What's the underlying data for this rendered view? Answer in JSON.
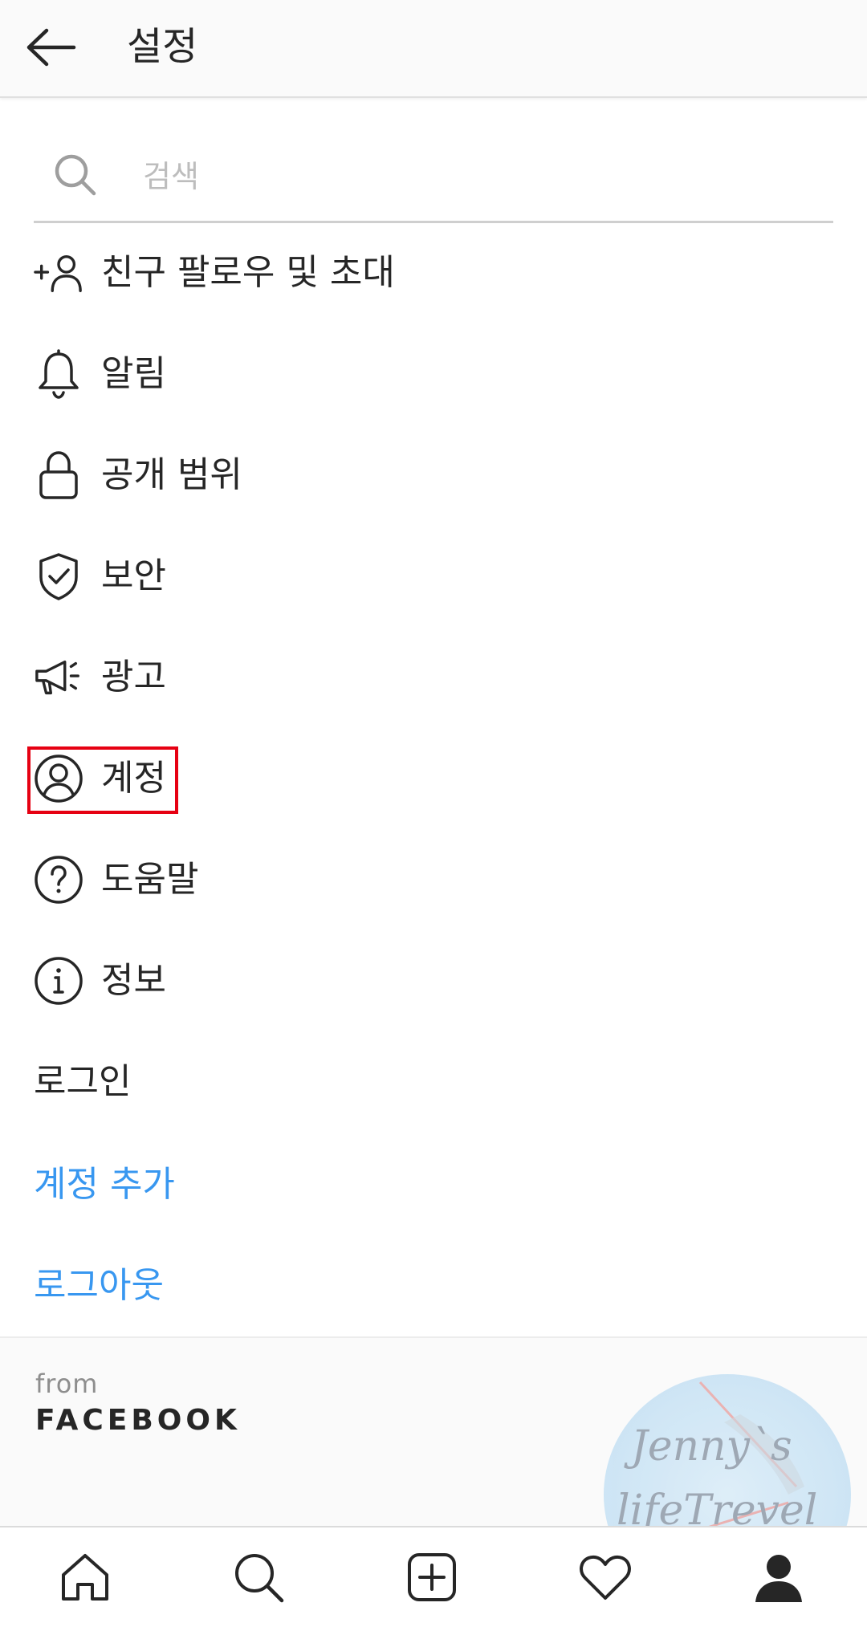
{
  "header": {
    "title": "설정",
    "back_icon": "arrow-left-icon"
  },
  "search": {
    "placeholder": "검색",
    "value": "",
    "icon": "search-icon"
  },
  "menu": {
    "items": [
      {
        "label": "친구 팔로우 및 초대",
        "icon": "add-person-icon"
      },
      {
        "label": "알림",
        "icon": "bell-icon"
      },
      {
        "label": "공개 범위",
        "icon": "lock-icon"
      },
      {
        "label": "보안",
        "icon": "shield-check-icon"
      },
      {
        "label": "광고",
        "icon": "megaphone-icon"
      },
      {
        "label": "계정",
        "icon": "account-circle-icon",
        "highlighted": true
      },
      {
        "label": "도움말",
        "icon": "help-circle-icon"
      },
      {
        "label": "정보",
        "icon": "info-circle-icon"
      }
    ],
    "login_label": "로그인",
    "add_account_label": "계정 추가",
    "logout_label": "로그아웃"
  },
  "footer": {
    "from": "from",
    "brand": "FACEBOOK"
  },
  "watermark": {
    "line1": "Jenny`s",
    "line2": "lifeTrevel"
  },
  "tabbar": {
    "tabs": [
      {
        "name": "home",
        "icon": "home-icon"
      },
      {
        "name": "search",
        "icon": "search-icon"
      },
      {
        "name": "new-post",
        "icon": "plus-square-icon"
      },
      {
        "name": "activity",
        "icon": "heart-icon"
      },
      {
        "name": "profile",
        "icon": "profile-icon",
        "active": true
      }
    ]
  },
  "colors": {
    "accent": "#3897f0",
    "highlight": "#e60012",
    "text": "#262626"
  }
}
